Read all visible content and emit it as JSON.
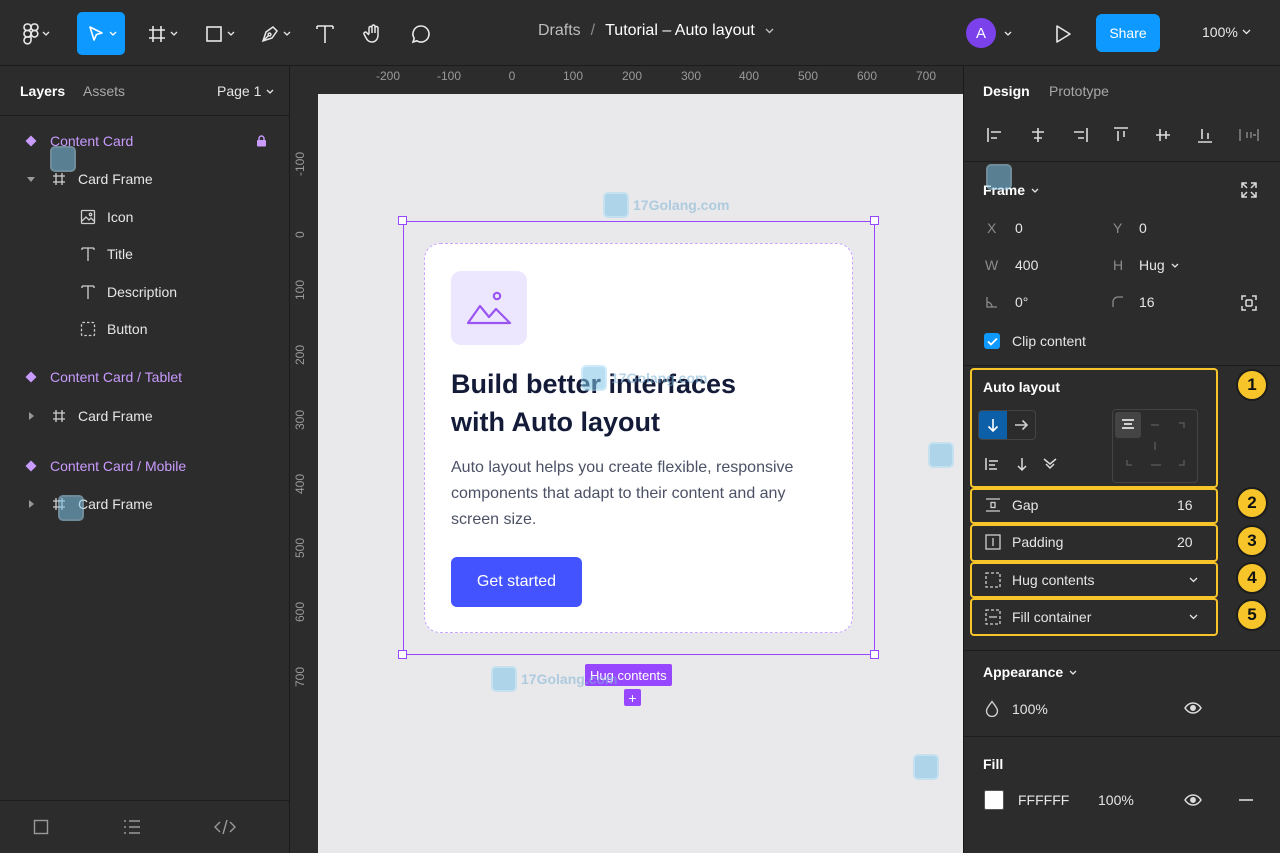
{
  "toolbar": {
    "tools": [
      "figma-menu",
      "move",
      "frame",
      "shape",
      "pen",
      "text",
      "hand",
      "comment"
    ],
    "breadcrumb": {
      "folder": "Drafts",
      "separator": "/",
      "file": "Tutorial – Auto layout"
    },
    "avatar_initial": "A",
    "share_label": "Share",
    "zoom": "100%"
  },
  "layers_panel": {
    "tabs": {
      "layers": "Layers",
      "assets": "Assets"
    },
    "page": "Page 1",
    "items": [
      {
        "label": "Content Card",
        "type": "component",
        "locked": true
      },
      {
        "label": "Card Frame",
        "type": "frame",
        "expanded": true
      },
      {
        "label": "Icon",
        "type": "image"
      },
      {
        "label": "Title",
        "type": "text"
      },
      {
        "label": "Description",
        "type": "text"
      },
      {
        "label": "Button",
        "type": "frame-dashed"
      },
      {
        "label": "Content Card / Tablet",
        "type": "component"
      },
      {
        "label": "Card Frame",
        "type": "frame",
        "expanded": false
      },
      {
        "label": "Content Card / Mobile",
        "type": "component"
      },
      {
        "label": "Card Frame",
        "type": "frame",
        "expanded": false
      }
    ]
  },
  "canvas": {
    "ruler_top": [
      "-200",
      "-100",
      "0",
      "100",
      "200",
      "300",
      "400",
      "500",
      "600",
      "700"
    ],
    "ruler_left": [
      "-100",
      "0",
      "100",
      "200",
      "300",
      "400",
      "500",
      "600",
      "700"
    ],
    "card": {
      "title": "Build better interfaces with Auto layout",
      "description": "Auto layout helps you create flexible, responsive components that adapt to their content and any screen size.",
      "button_label": "Get started"
    },
    "hug_label": "Hug contents",
    "add_symbol": "+"
  },
  "design_panel": {
    "tabs": {
      "design": "Design",
      "prototype": "Prototype"
    },
    "frame": {
      "title": "Frame",
      "x_label": "X",
      "x": "0",
      "y_label": "Y",
      "y": "0",
      "w_label": "W",
      "w": "400",
      "h_label": "H",
      "h": "Hug",
      "rotation": "0°",
      "radius": "16",
      "clip_label": "Clip content",
      "clip_checked": true
    },
    "auto_layout": {
      "title": "Auto layout",
      "direction": "vertical",
      "gap_label": "Gap",
      "gap": "16",
      "padding_label": "Padding",
      "padding": "20",
      "hug_label": "Hug contents",
      "fill_label": "Fill container",
      "badges": [
        "1",
        "2",
        "3",
        "4",
        "5"
      ]
    },
    "appearance": {
      "title": "Appearance",
      "opacity": "100%"
    },
    "fill": {
      "title": "Fill",
      "hex": "FFFFFF",
      "opacity": "100%",
      "swatch": "#FFFFFF"
    }
  },
  "watermark": {
    "text": "17Golang.com"
  },
  "colors": {
    "accent": "#0D99FF",
    "component": "#C99BFF",
    "selection": "#9747FF",
    "card_button": "#4353FF",
    "highlight": "#F7C52A"
  }
}
